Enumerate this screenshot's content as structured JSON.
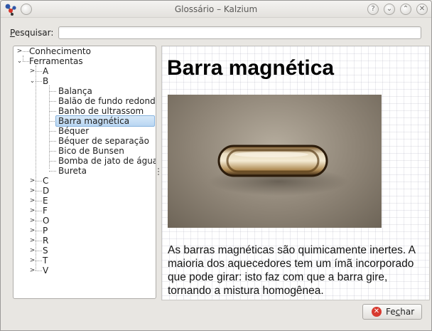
{
  "window": {
    "title": "Glossário – Kalzium",
    "buttons": {
      "help": "?",
      "minimize": "⌄",
      "maximize": "⌃",
      "close": "✕"
    }
  },
  "search": {
    "label_prefix": "P",
    "label_rest": "esquisar:",
    "value": "",
    "placeholder": ""
  },
  "tree": {
    "conhecimento": "Conhecimento",
    "ferramentas": "Ferramentas",
    "letter_a": "A",
    "letter_b": "B",
    "b_items": [
      "Balança",
      "Balão de fundo redondo",
      "Banho de ultrassom",
      "Barra magnética",
      "Béquer",
      "Béquer de separação",
      "Bico de Bunsen",
      "Bomba de jato de água",
      "Bureta"
    ],
    "other_letters": [
      "C",
      "D",
      "E",
      "F",
      "O",
      "P",
      "R",
      "S",
      "T",
      "V"
    ]
  },
  "entry": {
    "title": "Barra magnética",
    "description": "As barras magnéticas são quimicamente inertes. A maioria dos aquecedores tem um ímã incorporado que pode girar: isto faz com que a barra gire, tornando a mistura homogênea."
  },
  "close_button": {
    "before": "Fe",
    "accel": "c",
    "after": "har"
  },
  "icons": {
    "app": "kalzium-molecule-icon",
    "close_button_icon": "close-circle-icon"
  },
  "colors": {
    "selection": "#b9d6f2",
    "close_icon": "#d83a2f"
  }
}
